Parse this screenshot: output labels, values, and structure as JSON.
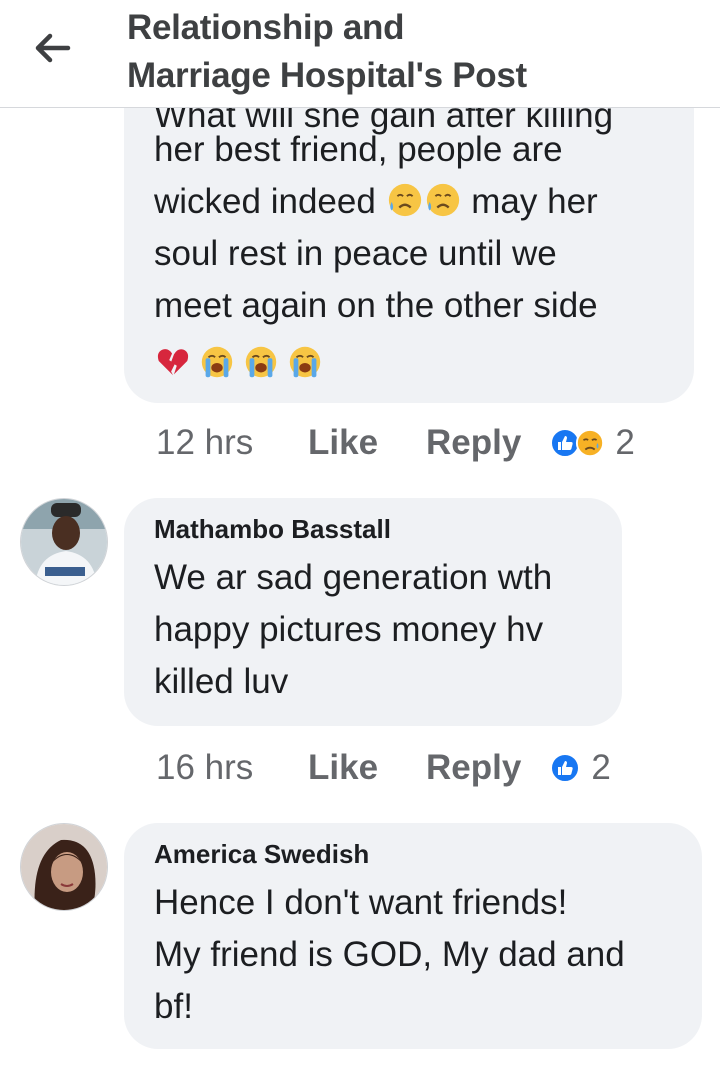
{
  "header": {
    "title": "Relationship and\nMarriage Hospital's Post"
  },
  "comments": [
    {
      "partial_line": "What will she gain after killing",
      "text": "her  best friend, people are\nwicked indeed",
      "text_after_emojis": " may her\nsoul rest in peace until we\nmeet again on the other side",
      "trailing_emojis": [
        "broken-heart-emoji",
        "loudly-crying-emoji",
        "loudly-crying-emoji",
        "loudly-crying-emoji"
      ],
      "inline_emojis": [
        "sad-relieved-emoji",
        "sad-relieved-emoji"
      ],
      "time": "12 hrs",
      "like_label": "Like",
      "reply_label": "Reply",
      "reactions": [
        "like-reaction-icon",
        "sad-reaction-icon"
      ],
      "reaction_count": "2"
    },
    {
      "author": "Mathambo Basstall",
      "text": "We ar sad generation wth\nhappy pictures money hv\nkilled luv",
      "time": "16 hrs",
      "like_label": "Like",
      "reply_label": "Reply",
      "reactions": [
        "like-reaction-icon"
      ],
      "reaction_count": "2"
    },
    {
      "author": "America Swedish",
      "text": "Hence I don't want friends!\nMy friend is  GOD, My dad and\nbf!"
    }
  ],
  "colors": {
    "bubble": "#f0f2f5",
    "meta_text": "#65676b",
    "like_blue": "#1877f2",
    "sad_yellow": "#f7b125"
  }
}
